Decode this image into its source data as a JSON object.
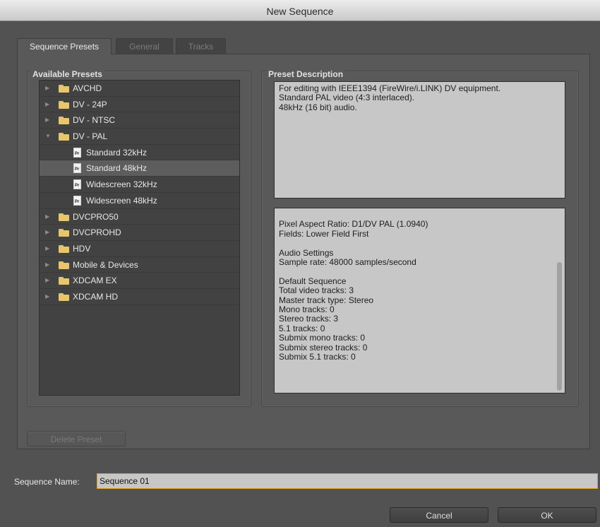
{
  "window": {
    "title": "New Sequence"
  },
  "tabs": [
    {
      "label": "Sequence Presets",
      "active": true
    },
    {
      "label": "General",
      "active": false
    },
    {
      "label": "Tracks",
      "active": false
    }
  ],
  "available_presets": {
    "title": "Available Presets",
    "items": [
      {
        "label": "AVCHD",
        "type": "folder",
        "expanded": false
      },
      {
        "label": "DV - 24P",
        "type": "folder",
        "expanded": false
      },
      {
        "label": "DV - NTSC",
        "type": "folder",
        "expanded": false
      },
      {
        "label": "DV - PAL",
        "type": "folder",
        "expanded": true
      },
      {
        "label": "Standard 32kHz",
        "type": "preset"
      },
      {
        "label": "Standard 48kHz",
        "type": "preset",
        "selected": true
      },
      {
        "label": "Widescreen 32kHz",
        "type": "preset"
      },
      {
        "label": "Widescreen 48kHz",
        "type": "preset"
      },
      {
        "label": "DVCPRO50",
        "type": "folder",
        "expanded": false
      },
      {
        "label": "DVCPROHD",
        "type": "folder",
        "expanded": false
      },
      {
        "label": "HDV",
        "type": "folder",
        "expanded": false
      },
      {
        "label": "Mobile & Devices",
        "type": "folder",
        "expanded": false
      },
      {
        "label": "XDCAM EX",
        "type": "folder",
        "expanded": false
      },
      {
        "label": "XDCAM HD",
        "type": "folder",
        "expanded": false
      }
    ],
    "preset_icon_text": "Pr"
  },
  "preset_description": {
    "title": "Preset Description",
    "summary": "For editing with IEEE1394 (FireWire/i.LINK) DV equipment.\nStandard PAL video (4:3 interlaced).\n48kHz (16 bit) audio.",
    "details": "Pixel Aspect Ratio: D1/DV PAL (1.0940)\nFields: Lower Field First\n\nAudio Settings\n Sample rate: 48000 samples/second\n\nDefault Sequence\n Total video tracks: 3\n Master track type: Stereo\n Mono tracks: 0\n Stereo tracks: 3\n 5.1 tracks: 0\n Submix mono tracks: 0\n Submix stereo tracks: 0\n Submix 5.1 tracks: 0"
  },
  "buttons": {
    "delete_preset": "Delete Preset",
    "cancel": "Cancel",
    "ok": "OK"
  },
  "sequence_name": {
    "label": "Sequence Name:",
    "value": "Sequence 01"
  },
  "colors": {
    "background": "#525252",
    "panel": "#595959",
    "focus_accent": "#e7a11c",
    "folder": "#e9c56d"
  }
}
